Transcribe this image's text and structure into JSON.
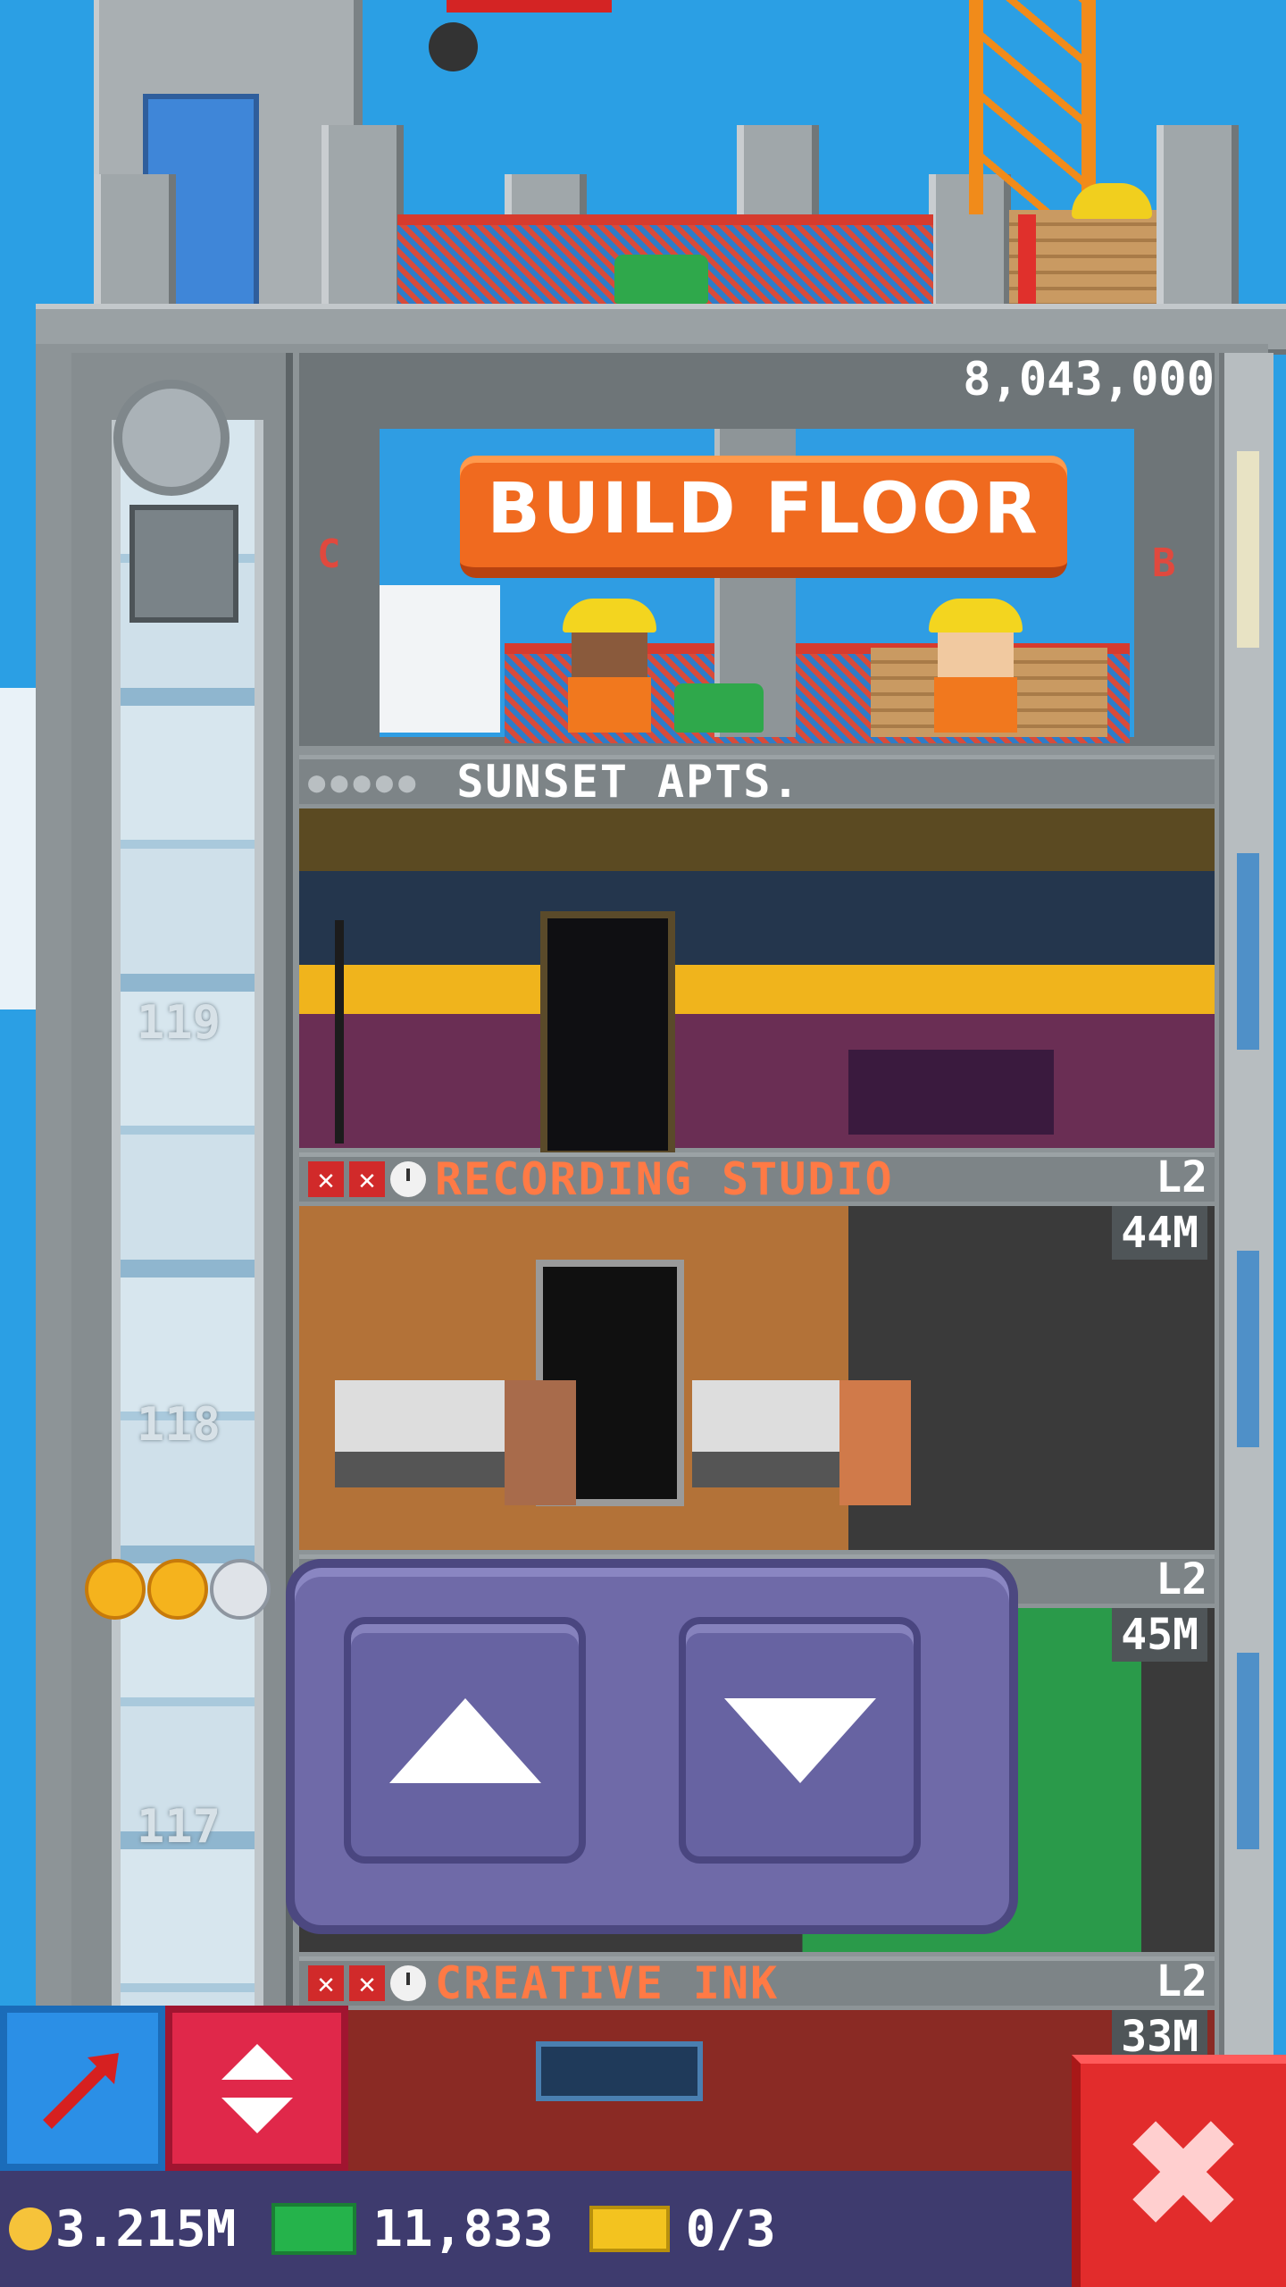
{
  "build": {
    "cost": "8,043,000",
    "button_label": "BUILD FLOOR",
    "left_marker": "C",
    "right_marker": "B"
  },
  "floors": [
    {
      "name": "SUNSET APTS.",
      "level": "",
      "price": "",
      "shaft_number": "119",
      "name_color": "#ffffff"
    },
    {
      "name": "RECORDING STUDIO",
      "level": "L2",
      "price": "44M",
      "shaft_number": "118",
      "name_color": "#ff7a45"
    },
    {
      "name": "",
      "level": "L2",
      "price": "45M",
      "shaft_number": "117",
      "name_color": "#ff7a45"
    },
    {
      "name": "CREATIVE INK",
      "level": "L2",
      "price": "33M",
      "shaft_number": "",
      "name_color": "#ff7a45"
    }
  ],
  "elevator_stars": {
    "filled": 2,
    "total": 3
  },
  "hud": {
    "coins": "3.215M",
    "bux": "11,833",
    "tickets": "0/3"
  },
  "colors": {
    "accent_orange": "#f06a1f",
    "popup_purple": "#6f6aa8",
    "close_red": "#e22c2c",
    "blue_button": "#2b8fe6",
    "red_button": "#e0284a"
  },
  "icons": {
    "arrow_button": "red-arrow-icon",
    "elevator_toggle": "up-down-arrows-icon",
    "close": "close-x-icon"
  }
}
